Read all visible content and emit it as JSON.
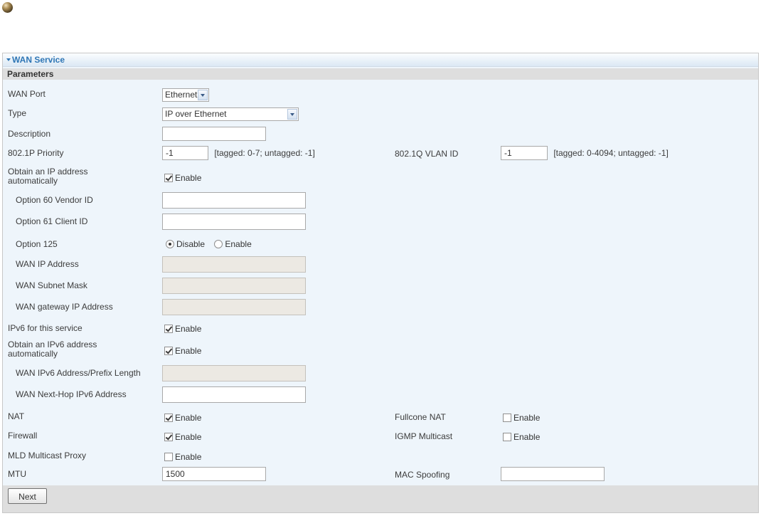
{
  "panel": {
    "title": "WAN Service"
  },
  "section": {
    "title": "Parameters"
  },
  "wan_port": {
    "label": "WAN Port",
    "value": "Ethernet"
  },
  "type": {
    "label": "Type",
    "value": "IP over Ethernet"
  },
  "description": {
    "label": "Description",
    "value": ""
  },
  "priority": {
    "label": "802.1P Priority",
    "value": "-1",
    "hint": "[tagged: 0-7; untagged: -1]"
  },
  "vlan": {
    "label": "802.1Q VLAN ID",
    "value": "-1",
    "hint": "[tagged: 0-4094; untagged: -1]"
  },
  "obtain_ip": {
    "label_line1": "Obtain an IP address",
    "label_line2": "automatically",
    "option": "Enable",
    "checked": true
  },
  "option60": {
    "label": "Option 60 Vendor ID",
    "value": ""
  },
  "option61": {
    "label": "Option 61 Client ID",
    "value": ""
  },
  "option125": {
    "label": "Option 125",
    "disable_label": "Disable",
    "enable_label": "Enable",
    "selected": "Disable"
  },
  "wan_ip": {
    "label": "WAN IP Address",
    "value": ""
  },
  "wan_mask": {
    "label": "WAN Subnet Mask",
    "value": ""
  },
  "wan_gateway": {
    "label": "WAN gateway IP Address",
    "value": ""
  },
  "ipv6_service": {
    "label": "IPv6 for this service",
    "option": "Enable",
    "checked": true
  },
  "obtain_ipv6": {
    "label_line1": "Obtain an IPv6 address",
    "label_line2": "automatically",
    "option": "Enable",
    "checked": true
  },
  "ipv6_prefix": {
    "label": "WAN IPv6 Address/Prefix Length",
    "value": ""
  },
  "ipv6_nexthop": {
    "label": "WAN Next-Hop IPv6 Address",
    "value": ""
  },
  "nat": {
    "label": "NAT",
    "option": "Enable",
    "checked": true
  },
  "fullcone_nat": {
    "label": "Fullcone NAT",
    "option": "Enable",
    "checked": false
  },
  "firewall": {
    "label": "Firewall",
    "option": "Enable",
    "checked": true
  },
  "igmp": {
    "label": "IGMP Multicast",
    "option": "Enable",
    "checked": false
  },
  "mld": {
    "label": "MLD Multicast Proxy",
    "option": "Enable",
    "checked": false
  },
  "mtu": {
    "label": "MTU",
    "value": "1500"
  },
  "mac_spoofing": {
    "label": "MAC Spoofing",
    "value": ""
  },
  "next_button": {
    "label": "Next"
  }
}
